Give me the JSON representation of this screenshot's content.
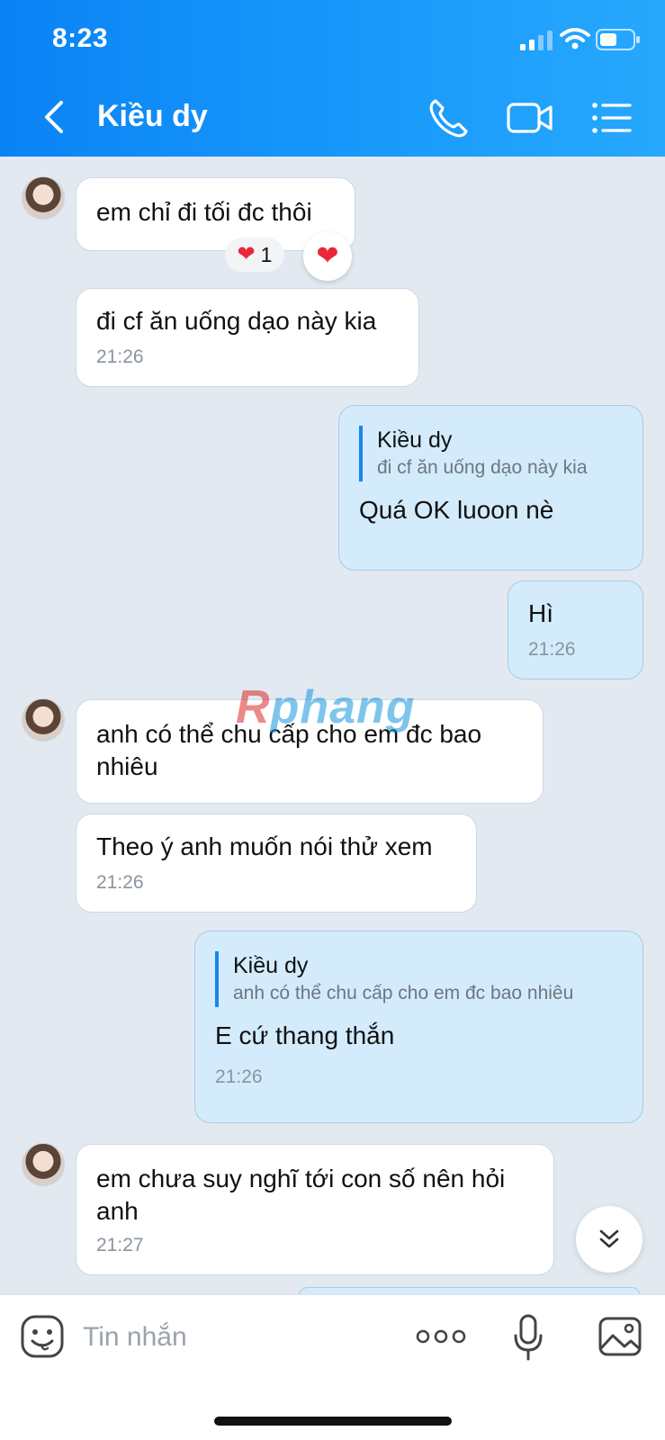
{
  "status_bar": {
    "time": "8:23"
  },
  "header": {
    "title": "Kiều dy"
  },
  "messages": [
    {
      "side": "in",
      "text": "em chỉ đi tối đc thôi",
      "reaction_count": "1"
    },
    {
      "side": "in",
      "text": "đi cf ăn uống dạo này kia",
      "time": "21:26"
    },
    {
      "side": "out",
      "quote_name": "Kiều dy",
      "quote_text": "đi cf ăn uống dạo này kia",
      "text": "Quá OK luoon nè"
    },
    {
      "side": "out",
      "text": "Hì",
      "time": "21:26"
    },
    {
      "side": "in",
      "text": "anh có thể chu cấp cho em đc bao nhiêu"
    },
    {
      "side": "in",
      "text": "Theo ý anh muốn nói thử xem",
      "time": "21:26"
    },
    {
      "side": "out",
      "quote_name": "Kiều dy",
      "quote_text": "anh có thể chu cấp cho em đc bao nhiêu",
      "text": "E cứ thang thắn",
      "time": "21:26"
    },
    {
      "side": "in",
      "text": "em chưa suy nghĩ tới con số nên hỏi anh",
      "time": "21:27"
    }
  ],
  "watermark": {
    "part1": "R",
    "part2": "phang"
  },
  "composer": {
    "placeholder": "Tin nhắn"
  },
  "colors": {
    "header": "#0a83f5",
    "outgoing_bubble": "#d3ebfb",
    "incoming_bubble": "#ffffff",
    "background": "#e2e9f1"
  },
  "icons": [
    "back-arrow-icon",
    "phone-icon",
    "video-camera-icon",
    "list-menu-icon",
    "heart-icon",
    "chevron-double-down-icon",
    "sticker-icon",
    "more-dots-icon",
    "microphone-icon",
    "image-icon"
  ]
}
